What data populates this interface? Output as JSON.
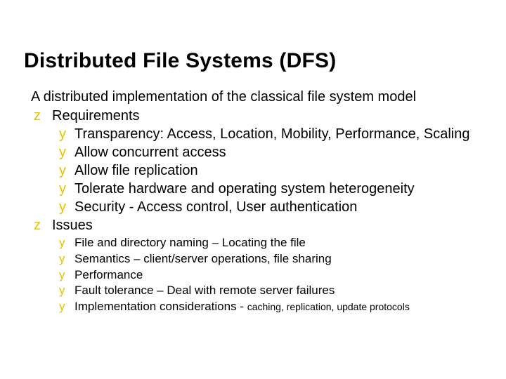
{
  "title": "Distributed File Systems (DFS)",
  "intro": "A distributed implementation of the classical file system model",
  "requirements": {
    "label": "Requirements",
    "items": [
      "Transparency: Access, Location, Mobility, Performance, Scaling",
      "Allow concurrent access",
      "Allow file replication",
      "Tolerate hardware and operating system heterogeneity",
      "Security - Access control,  User authentication"
    ]
  },
  "issues": {
    "label": "Issues",
    "items": [
      "File and directory naming – Locating the file",
      "Semantics – client/server operations,  file sharing",
      "Performance",
      "Fault tolerance – Deal with remote server failures"
    ],
    "impl_prefix": "Implementation considerations - ",
    "impl_suffix": "caching, replication, update protocols"
  }
}
